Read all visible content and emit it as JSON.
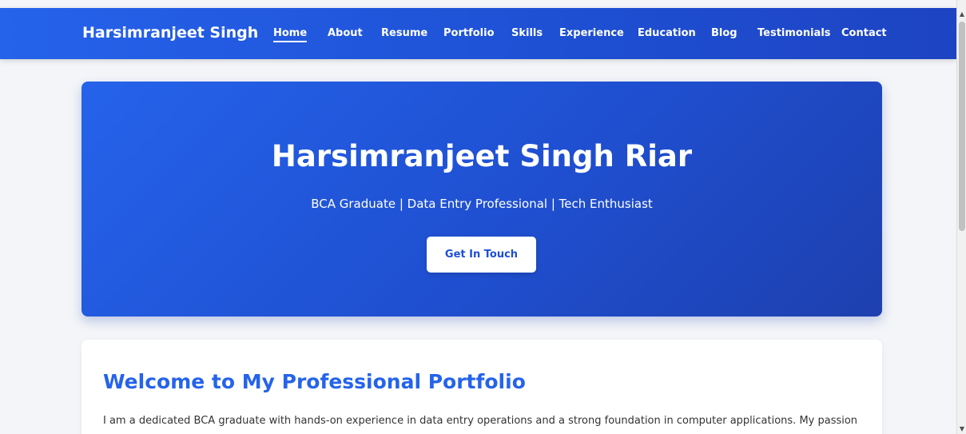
{
  "navbar": {
    "brand": "Harsimranjeet Singh",
    "links": [
      {
        "label": "Home",
        "active": true
      },
      {
        "label": "About"
      },
      {
        "label": "Resume"
      },
      {
        "label": "Portfolio"
      },
      {
        "label": "Skills"
      },
      {
        "label": "Experience"
      },
      {
        "label": "Education"
      },
      {
        "label": "Blog"
      },
      {
        "label": "Testimonials"
      },
      {
        "label": "Contact"
      }
    ]
  },
  "hero": {
    "title": "Harsimranjeet Singh Riar",
    "subtitle": "BCA Graduate | Data Entry Professional | Tech Enthusiast",
    "button": "Get In Touch"
  },
  "welcome": {
    "title": "Welcome to My Professional Portfolio",
    "text": "I am a dedicated BCA graduate with hands-on experience in data entry operations and a strong foundation in computer applications. My passion lies in"
  },
  "colors": {
    "primary": "#2563eb",
    "primary_dark": "#1e40af",
    "background": "#f3f5f8"
  },
  "icons": {
    "scroll_up": "▲",
    "scroll_down": "▼"
  }
}
